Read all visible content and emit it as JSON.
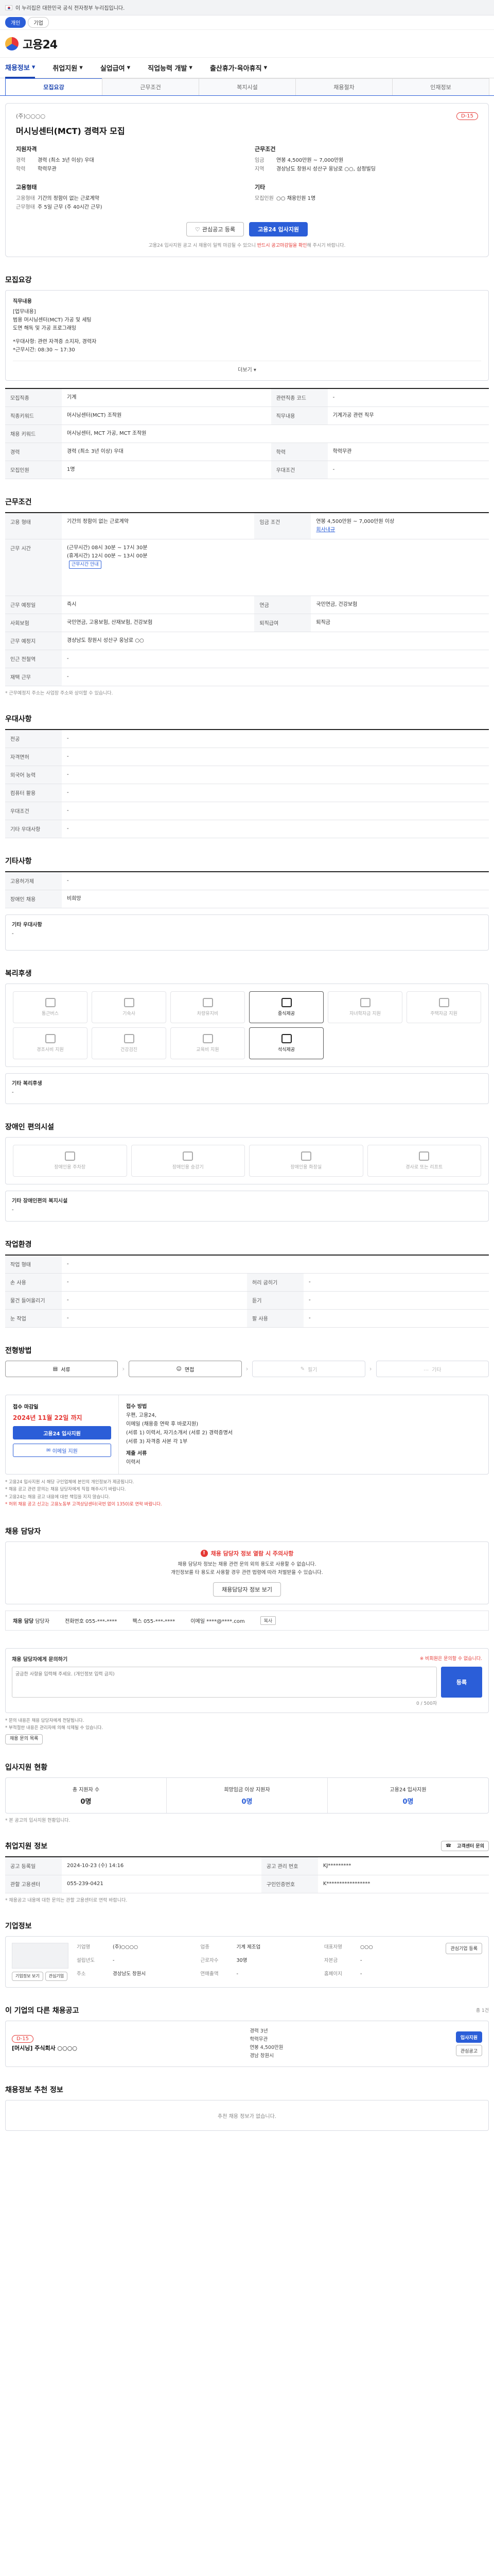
{
  "gov": {
    "text": "이 누리집은 대한민국 공식 전자정부 누리집입니다."
  },
  "util": {
    "items": [
      "개인",
      "기업"
    ]
  },
  "logo": {
    "text": "고용24"
  },
  "gnb": [
    {
      "label": "채용정보"
    },
    {
      "label": "취업지원"
    },
    {
      "label": "실업급여"
    },
    {
      "label": "직업능력 개발"
    },
    {
      "label": "출산휴가·육아휴직"
    }
  ],
  "subtabs": [
    "모집요강",
    "근무조건",
    "복지시설",
    "채용절차",
    "인재정보"
  ],
  "summary": {
    "company": "(주)○○○○",
    "dday": "D-15",
    "title": "머시닝센터(MCT) 경력자 모집",
    "qual_h": "지원자격",
    "qual": [
      {
        "k": "경력",
        "v": "경력 (최소 3년 이상) 우대"
      },
      {
        "k": "학력",
        "v": "학력무관"
      }
    ],
    "cond_h": "근무조건",
    "cond": [
      {
        "k": "임금",
        "v": "연봉 4,500만원 ~ 7,000만원"
      },
      {
        "k": "지역",
        "v": "경상남도 창원시 성산구 웅남로 ○○, 삼정빌딩"
      }
    ],
    "emp_h": "고용형태",
    "emp": [
      {
        "k": "고용형태",
        "v": "기간의 정함이 없는 근로계약"
      },
      {
        "k": "근무형태",
        "v": "주 5일 근무 (주 40시간 근무)"
      }
    ],
    "etc_h": "기타",
    "etc": [
      {
        "k": "모집인원",
        "v": "○○ 채용인원 1명"
      }
    ],
    "btn_save": "관심공고 등록",
    "btn_apply": "고용24 입사지원",
    "note_pre": "고용24 입사지원 공고 시 채용이 일찍 마감될 수 있으니 ",
    "note_red": "반드시 공고마감일을 확인",
    "note_post": "해 주시기 바랍니다."
  },
  "recruit": {
    "h": "모집요강",
    "desc_title": "직무내용",
    "desc": [
      "[업무내용]",
      "범용 머시닝센터(MCT) 가공 및 세팅",
      "도면 해독 및 가공 프로그래밍",
      "",
      "*우대사항: 관련 자격증 소지자, 경력자",
      "*근무시간: 08:30 ~ 17:30"
    ],
    "more": "더보기",
    "rows": [
      [
        {
          "k": "모집직종",
          "v": "기계"
        },
        {
          "k": "관련직종 코드",
          "v": "-"
        }
      ],
      [
        {
          "k": "직종키워드",
          "v": "머시닝센터(MCT) 조작원"
        },
        {
          "k": "직무내용",
          "v": "기계가공 관련 직무"
        }
      ],
      [
        {
          "k": "채용 키워드",
          "v": "머시닝센터, MCT 가공, MCT 조작원"
        },
        {
          "k": "",
          "v": ""
        }
      ],
      [
        {
          "k": "경력",
          "v": "경력 (최소 3년 이상) 우대"
        },
        {
          "k": "학력",
          "v": "학력무관"
        }
      ],
      [
        {
          "k": "모집인원",
          "v": "1명"
        },
        {
          "k": "우대조건",
          "v": "-"
        }
      ]
    ]
  },
  "work": {
    "h": "근무조건",
    "rows": [
      {
        "k": "고용 형태",
        "v": "기간의 정함이 없는 근로계약",
        "k2": "임금 조건",
        "v2": "연봉 4,500만원 ~ 7,000만원 이상",
        "tag": "회사내규"
      },
      {
        "k": "근무 시간",
        "v": "(근무시간) 08시 30분 ~ 17시 30분\n(휴게시간) 12시 00분 ~ 13시 00분",
        "tag": "근무시간 안내",
        "k2": "",
        "v2": ""
      },
      {
        "k": "근무 예정일",
        "v": "즉시",
        "k2": "연금",
        "v2": "국민연금, 건강보험"
      },
      {
        "k": "사회보험",
        "v": "국민연금, 고용보험, 산재보험, 건강보험",
        "k2": "퇴직급여",
        "v2": "퇴직금"
      },
      {
        "k": "근무 예정지",
        "v": "경상남도 창원시 성산구 웅남로 ○○",
        "k2": "",
        "v2": ""
      },
      {
        "k": "인근 전철역",
        "v": "-",
        "k2": "",
        "v2": ""
      },
      {
        "k": "재택 근무",
        "v": "-",
        "k2": "",
        "v2": ""
      }
    ],
    "note": "* 근무예정지 주소는 사업장 주소와 상이할 수 있습니다."
  },
  "prefer": {
    "h": "우대사항",
    "rows": [
      {
        "k": "전공",
        "v": "-"
      },
      {
        "k": "자격면허",
        "v": "-"
      },
      {
        "k": "외국어 능력",
        "v": "-"
      },
      {
        "k": "컴퓨터 활용",
        "v": "-"
      },
      {
        "k": "우대조건",
        "v": "-"
      },
      {
        "k": "기타 우대사항",
        "v": "-"
      }
    ]
  },
  "other": {
    "h": "기타사항",
    "rows": [
      {
        "k": "고용허가제",
        "v": "-"
      },
      {
        "k": "장애인 채용",
        "v": "비희망"
      }
    ],
    "memo_h": "기타 우대사항",
    "memo": "-"
  },
  "welfare": {
    "h": "복리후생",
    "icons": [
      {
        "label": "통근버스",
        "on": false
      },
      {
        "label": "기숙사",
        "on": false
      },
      {
        "label": "차량유지비",
        "on": false
      },
      {
        "label": "중식제공",
        "on": true
      },
      {
        "label": "자녀학자금 지원",
        "on": false
      },
      {
        "label": "주택자금 지원",
        "on": false
      },
      {
        "label": "경조사비 지원",
        "on": false
      },
      {
        "label": "건강검진",
        "on": false
      },
      {
        "label": "교육비 지원",
        "on": false
      },
      {
        "label": "석식제공",
        "on": true
      }
    ],
    "memo_h": "기타 복리후생",
    "memo": "-"
  },
  "disability": {
    "h": "장애인 편의시설",
    "icons": [
      {
        "label": "장애인용 주차장"
      },
      {
        "label": "장애인용 승강기"
      },
      {
        "label": "장애인용 화장실"
      },
      {
        "label": "경사로 또는 리프트"
      }
    ],
    "memo_h": "기타 장애인편의 복지시설",
    "memo": "-"
  },
  "env": {
    "h": "작업환경",
    "rows": [
      [
        {
          "k": "작업 형태",
          "v": "-"
        },
        {
          "k": "",
          "v": ""
        }
      ],
      [
        {
          "k": "손 사용",
          "v": "-"
        },
        {
          "k": "허리 굽히기",
          "v": "-"
        }
      ],
      [
        {
          "k": "물건 들어올리기",
          "v": "-"
        },
        {
          "k": "듣기",
          "v": "-"
        }
      ],
      [
        {
          "k": "눈 작업",
          "v": "-"
        },
        {
          "k": "팔 사용",
          "v": "-"
        }
      ]
    ]
  },
  "process": {
    "h": "전형방법",
    "steps": [
      {
        "label": "서류",
        "on": true
      },
      {
        "label": "면접",
        "on": true
      },
      {
        "label": "필기",
        "on": false
      },
      {
        "label": "기타",
        "on": false
      }
    ]
  },
  "apply": {
    "dl_label": "접수 마감일",
    "dl_date": "2024년 11월 22일 까지",
    "btn1": "고용24 입사지원",
    "btn2": "이메일 지원",
    "method_h": "접수 방법",
    "method": [
      "우편, 고용24,",
      "이메일 (채용중 연락 후 바로지원)",
      "(서류 1) 이력서, 자기소개서 (서류 2) 경력증명서",
      "(서류 3) 자격증 사본 각 1부"
    ],
    "form_h": "제출 서류",
    "form": "이력서"
  },
  "notes": [
    "* 고용24 입사지원 시 해당 구인업체에 본인의 개인정보가 제공됩니다.",
    "* 채용 공고 관련 문의는 채용 담당자에게 직접 해주시기 바랍니다.",
    "* 고용24는 채용 공고 내용에 대한 책임을 지지 않습니다.",
    "* 허위 채용 공고 신고는 고용노동부 고객상담센터(국번 없이 1350)로 연락 바랍니다."
  ],
  "contact": {
    "h": "채용 담당자",
    "warn_h": "채용 담당자 정보 열람 시 주의사항",
    "warn_body": "채용 담당자 정보는 채용 관련 문의 외의 용도로 사용할 수 없습니다.\n개인정보를 타 용도로 사용할 경우 관련 법령에 따라 처벌받을 수 있습니다.",
    "btn": "채용담당자 정보 보기",
    "name_k": "채용 담당",
    "name": "담당자",
    "phone_k": "전화번호",
    "phone": "055-***-****",
    "fax_k": "팩스",
    "fax": "055-***-****",
    "email_k": "이메일",
    "email": "****@****.com",
    "copy": "복사"
  },
  "inquiry": {
    "h": "채용 담당자에게 문의하기",
    "sub": "※ 비회원은 문의할 수 없습니다.",
    "placeholder": "궁금한 사항을 입력해 주세요. (개인정보 입력 금지)",
    "btn": "등록",
    "count": "0 / 500자",
    "notes": [
      "* 문의 내용은 채용 담당자에게 전달됩니다.",
      "* 부적절한 내용은 관리자에 의해 삭제될 수 있습니다."
    ],
    "list_btn": "채용 문의 목록"
  },
  "applicants": {
    "h": "입사지원 현황",
    "items": [
      {
        "t": "총 지원자 수",
        "n": "0명"
      },
      {
        "t": "희망임금 이상 지원자",
        "n": "0명"
      },
      {
        "t": "고용24 입사지원",
        "n": "0명"
      }
    ],
    "note": "* 본 공고의 입사지원 현황입니다."
  },
  "agency": {
    "h": "취업지원 정보",
    "btn": "고객센터 문의",
    "rows": [
      [
        {
          "k": "공고 등록일",
          "v": "2024-10-23 (수) 14:16"
        },
        {
          "k": "공고 관리 번호",
          "v": "KJ*********"
        }
      ],
      [
        {
          "k": "관할 고용센터",
          "v": "055-239-0421"
        },
        {
          "k": "구인인증번호",
          "v": "K*****************"
        }
      ]
    ],
    "note": "* 채용공고 내용에 대한 문의는 관할 고용센터로 연락 바랍니다."
  },
  "biz": {
    "h": "기업정보",
    "rows": [
      {
        "k": "기업명",
        "v": "(주)○○○○"
      },
      {
        "k": "업종",
        "v": "기계 제조업"
      },
      {
        "k": "대표자명",
        "v": "○○○"
      },
      {
        "k": "설립년도",
        "v": "-"
      },
      {
        "k": "근로자수",
        "v": "30명"
      },
      {
        "k": "자본금",
        "v": "-"
      },
      {
        "k": "주소",
        "v": "경상남도 창원시"
      },
      {
        "k": "연매출액",
        "v": "-"
      },
      {
        "k": "홈페이지",
        "v": "-"
      }
    ],
    "btn1": "기업정보 보기",
    "btn2": "관심기업",
    "btn3": "관심기업 등록"
  },
  "otherjobs": {
    "h": "이 기업의 다른 채용공고",
    "sub": "총 1건",
    "company": "D-15",
    "title": "[머시닝] 주식회사 ○○○○",
    "meta": [
      "경력 3년",
      "학력무관",
      "연봉 4,500만원",
      "경남 창원시"
    ],
    "btns": [
      "입사지원",
      "관심공고"
    ]
  },
  "rec": {
    "h": "채용정보 추천 정보",
    "empty": "추천 채용 정보가 없습니다."
  }
}
